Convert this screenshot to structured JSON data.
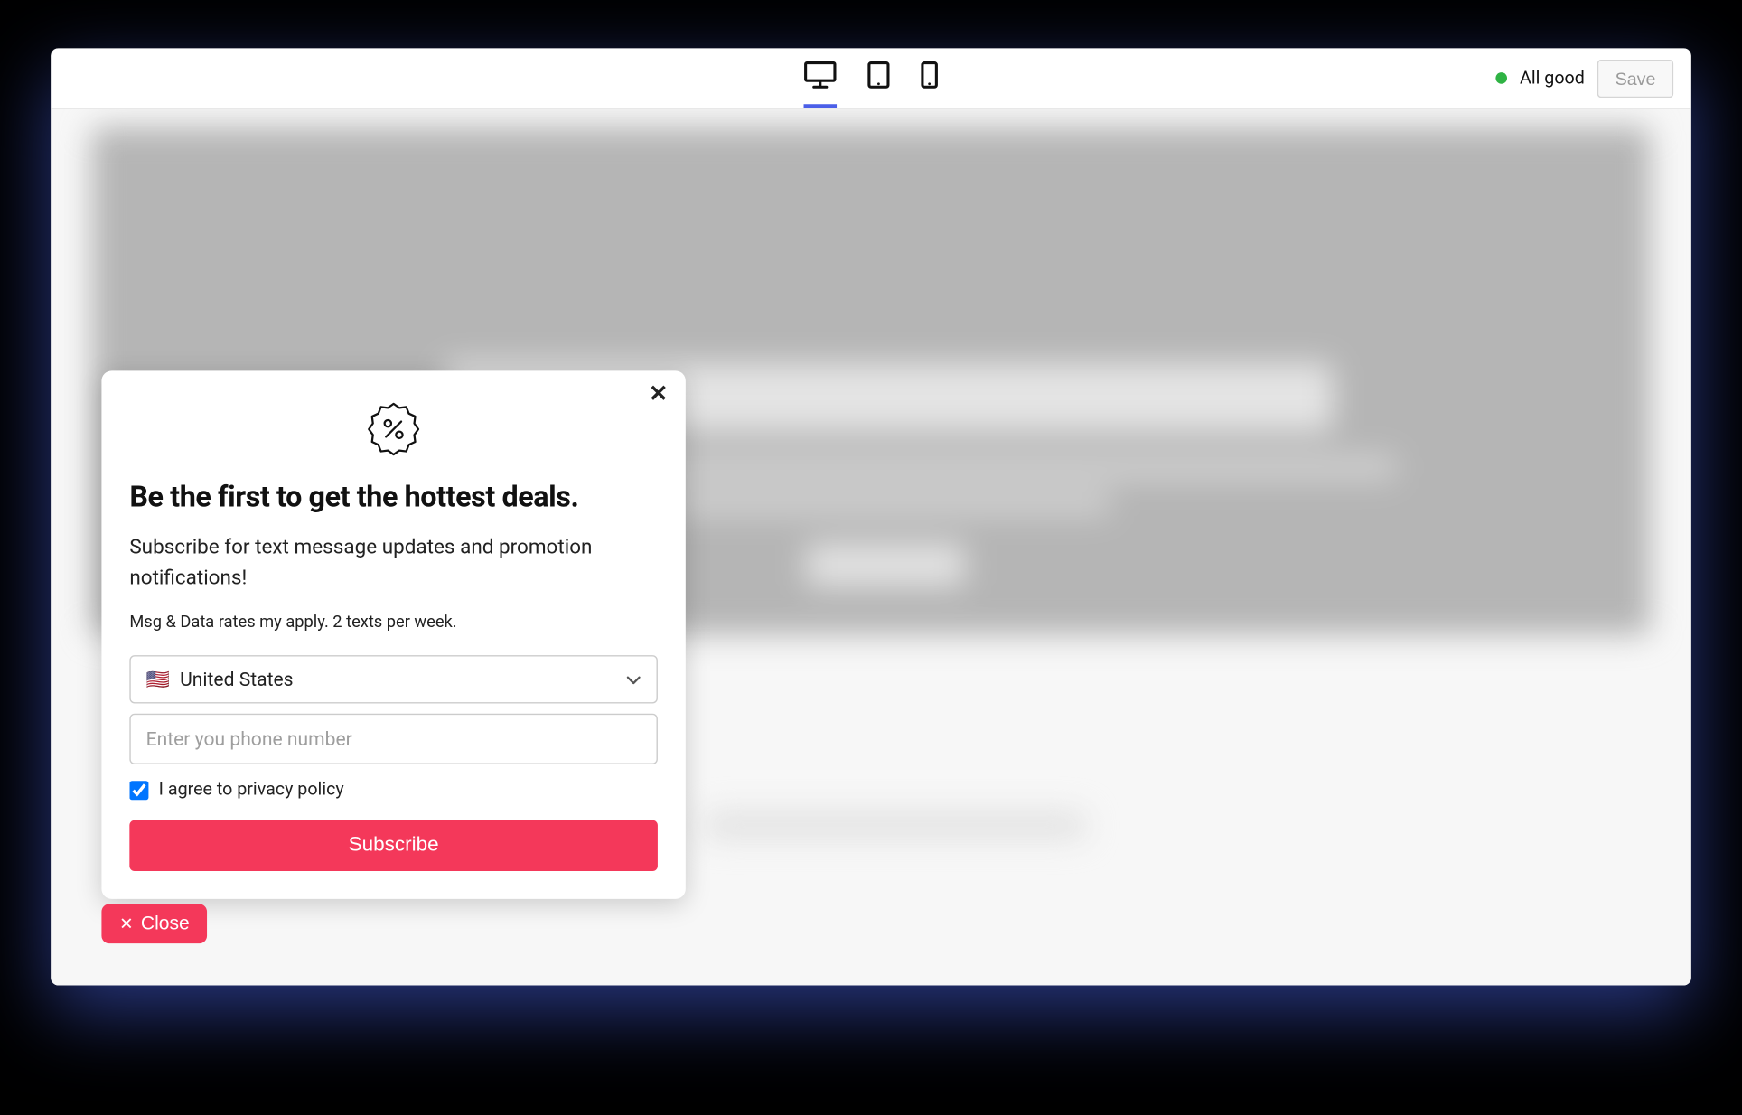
{
  "topbar": {
    "status_text": "All good",
    "save_label": "Save"
  },
  "popup": {
    "title": "Be the first to get the hottest deals.",
    "subtitle": "Subscribe for text message updates and promotion notifications!",
    "fine_print": "Msg & Data rates my apply. 2 texts per week.",
    "country": {
      "flag": "🇺🇸",
      "name": "United States"
    },
    "phone_placeholder": "Enter you phone number",
    "agree_label": "I agree to privacy policy",
    "subscribe_label": "Subscribe"
  },
  "close_pill_label": "Close"
}
